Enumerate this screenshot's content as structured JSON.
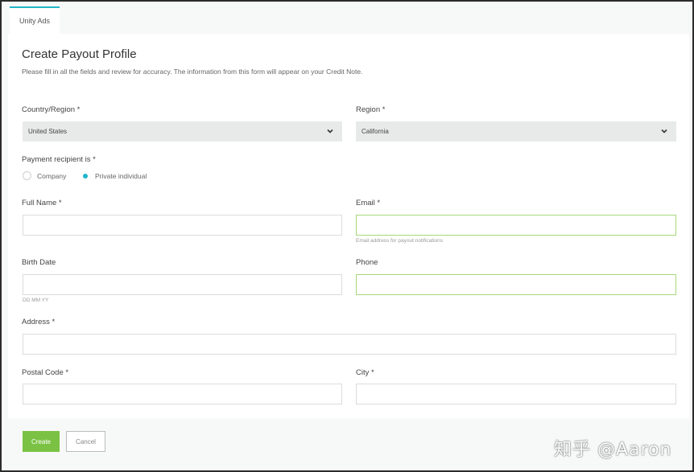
{
  "tab": {
    "label": "Unity Ads"
  },
  "form": {
    "title": "Create Payout Profile",
    "subtitle": "Please fill in all the fields and review for accuracy. The information from this form will appear on your Credit Note.",
    "country": {
      "label": "Country/Region *",
      "value": "United States"
    },
    "region": {
      "label": "Region *",
      "value": "California"
    },
    "recipient": {
      "label": "Payment recipient is *",
      "options": [
        {
          "label": "Company",
          "selected": false
        },
        {
          "label": "Private individual",
          "selected": true
        }
      ]
    },
    "full_name": {
      "label": "Full Name *",
      "value": ""
    },
    "email": {
      "label": "Email *",
      "value": "",
      "help": "Email address for payout notifications"
    },
    "birth_date": {
      "label": "Birth Date",
      "value": "",
      "help": "DD MM YY"
    },
    "phone": {
      "label": "Phone",
      "value": ""
    },
    "address": {
      "label": "Address *",
      "value": ""
    },
    "postal_code": {
      "label": "Postal Code *",
      "value": ""
    },
    "city": {
      "label": "City *",
      "value": ""
    }
  },
  "actions": {
    "create_label": "Create",
    "cancel_label": "Cancel"
  },
  "watermark": "知乎 @Aaron",
  "colors": {
    "accent": "#21b6c9",
    "primary_button": "#7bc244",
    "valid_border": "#a7d77a"
  }
}
